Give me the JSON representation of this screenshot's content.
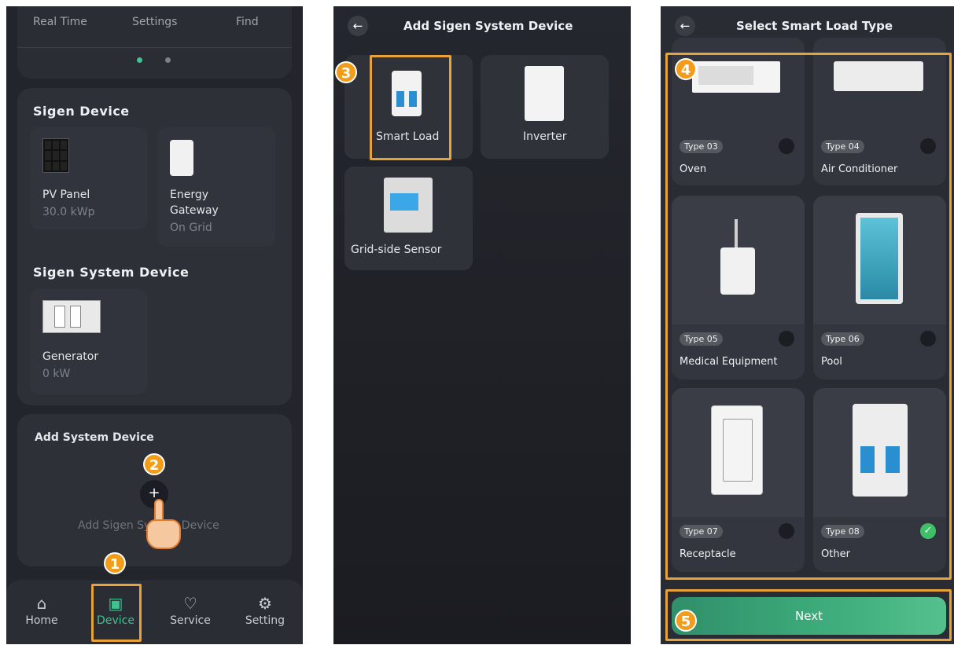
{
  "screen1": {
    "top_tabs": [
      "Real Time",
      "Settings",
      "Find"
    ],
    "sigen_device": {
      "title": "Sigen Device",
      "items": [
        {
          "name": "PV Panel",
          "value": "30.0 kWp"
        },
        {
          "name_line1": "Energy",
          "name_line2": "Gateway",
          "value": "On Grid"
        }
      ]
    },
    "sigen_system_device": {
      "title": "Sigen System Device",
      "items": [
        {
          "name": "Generator",
          "value": "0 kW"
        }
      ]
    },
    "add_system_device": {
      "title": "Add System Device",
      "button_symbol": "+",
      "hint": "Add Sigen System Device"
    },
    "bottom_nav": [
      {
        "label": "Home",
        "icon": "home-icon"
      },
      {
        "label": "Device",
        "icon": "device-icon"
      },
      {
        "label": "Service",
        "icon": "service-icon"
      },
      {
        "label": "Setting",
        "icon": "gear-icon"
      }
    ]
  },
  "screen2": {
    "title": "Add Sigen System Device",
    "devices": [
      "Smart Load",
      "Inverter",
      "Grid-side Sensor"
    ]
  },
  "screen3": {
    "title": "Select Smart Load Type",
    "types": [
      {
        "badge": "Type 03",
        "name": "Oven",
        "selected": false
      },
      {
        "badge": "Type 04",
        "name": "Air Conditioner",
        "selected": false
      },
      {
        "badge": "Type 05",
        "name": "Medical Equipment",
        "selected": false
      },
      {
        "badge": "Type 06",
        "name": "Pool",
        "selected": false
      },
      {
        "badge": "Type 07",
        "name": "Receptacle",
        "selected": false
      },
      {
        "badge": "Type 08",
        "name": "Other",
        "selected": true
      }
    ],
    "next_label": "Next"
  },
  "steps": [
    "1",
    "2",
    "3",
    "4",
    "5"
  ],
  "colors": {
    "accent_orange": "#e8a23a",
    "step_orange": "#f39c1a",
    "next_green": "#3fae7c",
    "selected_green": "#3fbf67",
    "active_dot": "#3ec28f"
  }
}
